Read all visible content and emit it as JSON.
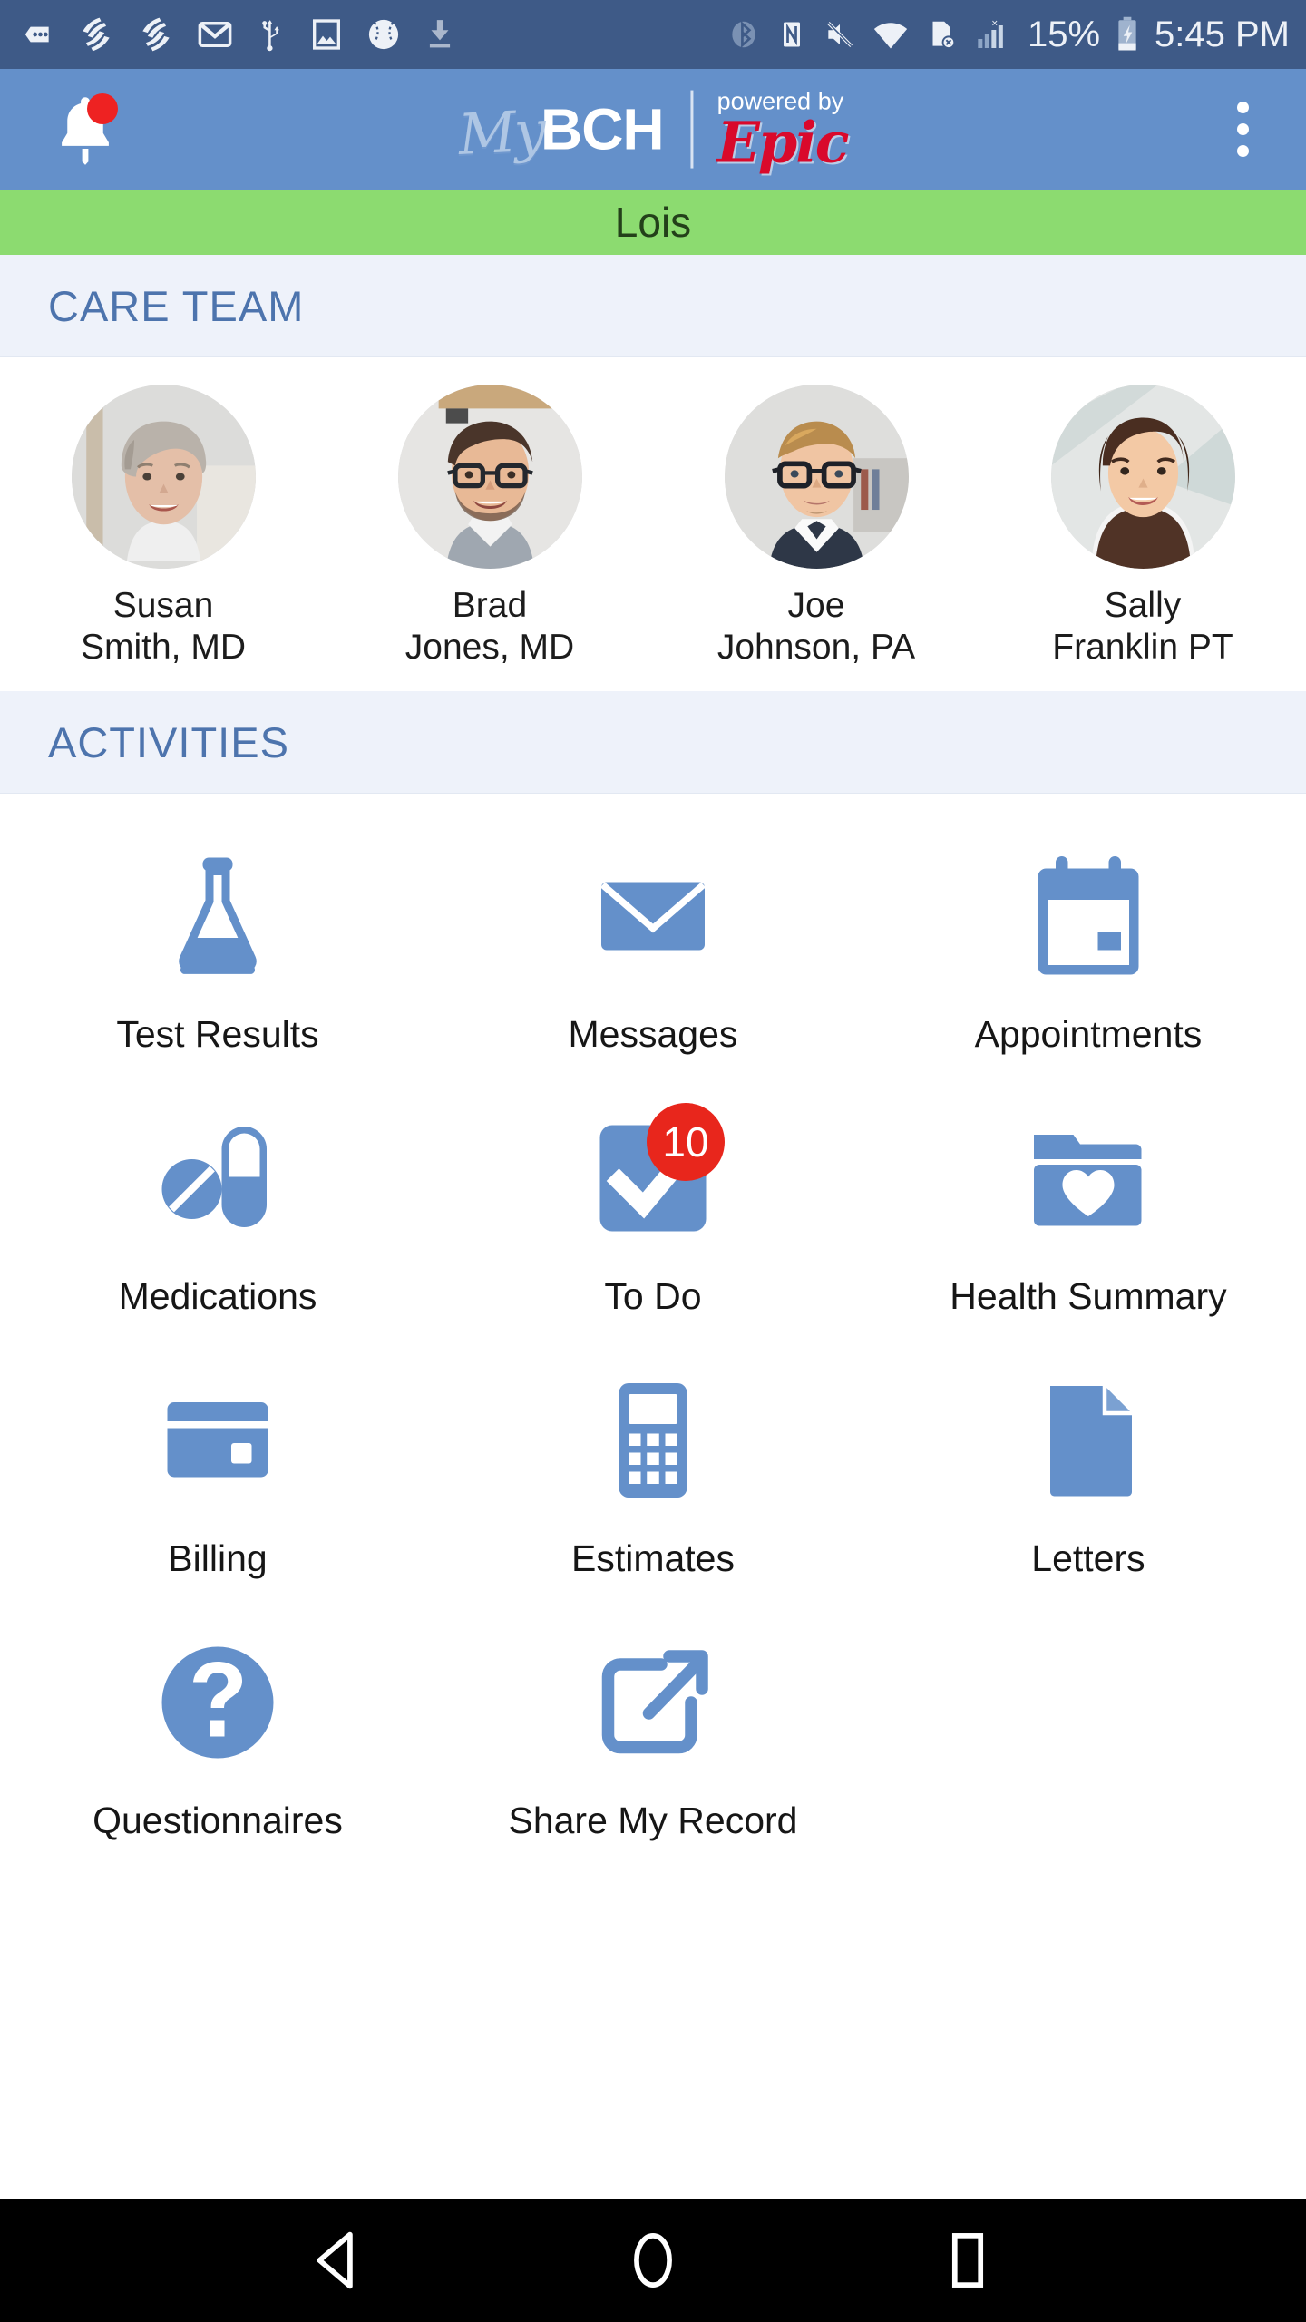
{
  "status_bar": {
    "icons": [
      "more-messages-icon",
      "epic-haiku-icon",
      "epic-haiku-icon",
      "gmail-icon",
      "usb-icon",
      "screenshot-icon",
      "baseball-icon",
      "download-icon"
    ],
    "right_icons": [
      "bluetooth-icon",
      "nfc-icon",
      "vibrate-off-icon",
      "wifi-icon",
      "no-sim-card-icon",
      "cellular-signal-icon"
    ],
    "battery_percent": "15%",
    "battery_state": "charging-battery-icon",
    "time": "5:45 PM"
  },
  "header": {
    "notification_icon": "bell-icon",
    "has_notification": true,
    "logo_my": "My",
    "logo_bch": "BCH",
    "powered_by": "powered by",
    "epic": "Epic",
    "overflow_icon": "kebab-menu-icon",
    "bg_color": "#6490CA"
  },
  "patient_bar": {
    "name": "Lois",
    "bg_color": "#8CDB70",
    "text_color": "#23401A"
  },
  "care_team": {
    "title": "CARE TEAM",
    "members": [
      {
        "first": "Susan",
        "last": "Smith, MD",
        "avatar": "avatar-susan-smith"
      },
      {
        "first": "Brad",
        "last": "Jones, MD",
        "avatar": "avatar-brad-jones"
      },
      {
        "first": "Joe",
        "last": "Johnson, PA",
        "avatar": "avatar-joe-johnson"
      },
      {
        "first": "Sally",
        "last": "Franklin PT",
        "avatar": "avatar-sally-franklin"
      }
    ]
  },
  "activities": {
    "title": "ACTIVITIES",
    "accent_color": "#6490CA",
    "badge_color": "#E8261C",
    "items": [
      {
        "label": "Test Results",
        "icon": "flask-icon",
        "badge": null
      },
      {
        "label": "Messages",
        "icon": "envelope-icon",
        "badge": null
      },
      {
        "label": "Appointments",
        "icon": "calendar-icon",
        "badge": null
      },
      {
        "label": "Medications",
        "icon": "pills-icon",
        "badge": null
      },
      {
        "label": "To Do",
        "icon": "checkmark-icon",
        "badge": "10"
      },
      {
        "label": "Health Summary",
        "icon": "folder-heart-icon",
        "badge": null
      },
      {
        "label": "Billing",
        "icon": "credit-card-icon",
        "badge": null
      },
      {
        "label": "Estimates",
        "icon": "calculator-icon",
        "badge": null
      },
      {
        "label": "Letters",
        "icon": "document-icon",
        "badge": null
      },
      {
        "label": "Questionnaires",
        "icon": "question-mark-icon",
        "badge": null
      },
      {
        "label": "Share My Record",
        "icon": "external-link-icon",
        "badge": null
      }
    ]
  },
  "nav_bar": {
    "back": "back-triangle-icon",
    "home": "home-circle-icon",
    "recents": "recents-square-icon"
  }
}
